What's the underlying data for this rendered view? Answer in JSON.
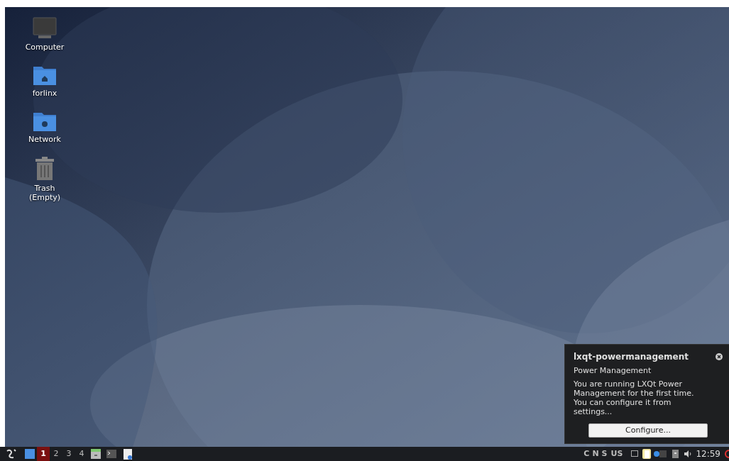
{
  "desktop": {
    "icons": [
      {
        "kind": "computer",
        "label": "Computer"
      },
      {
        "kind": "home",
        "label": "forlinx"
      },
      {
        "kind": "network",
        "label": "Network"
      },
      {
        "kind": "trash",
        "label": "Trash\n(Empty)"
      }
    ]
  },
  "notification": {
    "title": "lxqt-powermanagement",
    "subtitle": "Power Management",
    "body": "You are running LXQt Power Management for the first time.\nYou can configure it from settings...",
    "button": "Configure..."
  },
  "taskbar": {
    "workspaces": [
      {
        "label": "1",
        "selected": true
      },
      {
        "label": "2",
        "selected": false
      },
      {
        "label": "3",
        "selected": false
      },
      {
        "label": "4",
        "selected": false
      }
    ],
    "keyboard_indicators": [
      "C",
      "N",
      "S"
    ],
    "layout": "US",
    "clock": "12:59"
  }
}
